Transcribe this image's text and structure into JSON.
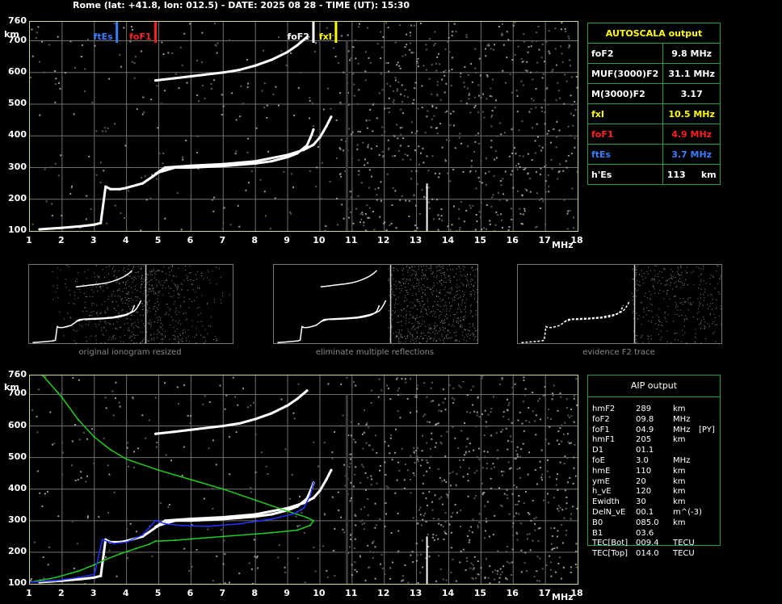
{
  "header": {
    "title": "Rome (lat: +41.8, lon: 012.5) - DATE: 2025 08 28 - TIME (UT): 15:30"
  },
  "axes": {
    "y_ticks": [
      "760",
      "700",
      "600",
      "500",
      "400",
      "300",
      "200",
      "100"
    ],
    "y_unit": "km",
    "x_ticks": [
      "1",
      "2",
      "3",
      "4",
      "5",
      "6",
      "7",
      "8",
      "9",
      "10",
      "11",
      "12",
      "13",
      "14",
      "15",
      "16",
      "17",
      "18"
    ],
    "x_unit": "MHz"
  },
  "markers": [
    {
      "label": "ftEs",
      "freq": 3.7,
      "color": "#3a7dff"
    },
    {
      "label": "foF1",
      "freq": 4.9,
      "color": "#ff2020"
    },
    {
      "label": "foF2",
      "freq": 9.8,
      "color": "#ffffff"
    },
    {
      "label": "fxI",
      "freq": 10.5,
      "color": "#ffff00"
    }
  ],
  "thumbnails": [
    {
      "caption": "original ionogram resized"
    },
    {
      "caption": "eliminate multiple reflections"
    },
    {
      "caption": "evidence F2 trace"
    }
  ],
  "autoscala": {
    "title": "AUTOSCALA output",
    "rows": [
      {
        "name": "foF2",
        "value": "9.8 MHz",
        "color": "#ffffff"
      },
      {
        "name": "MUF(3000)F2",
        "value": "31.1 MHz",
        "color": "#ffffff"
      },
      {
        "name": "M(3000)F2",
        "value": "3.17",
        "color": "#ffffff"
      },
      {
        "name": "fxI",
        "value": "10.5 MHz",
        "color": "#ffff00"
      },
      {
        "name": "foF1",
        "value": "4.9 MHz",
        "color": "#ff2020"
      },
      {
        "name": "ftEs",
        "value": "3.7 MHz",
        "color": "#3a7dff"
      },
      {
        "name": "h'Es",
        "value": "113     km",
        "color": "#ffffff"
      }
    ]
  },
  "aip": {
    "title": "AIP output",
    "rows": [
      {
        "name": "hmF2",
        "value": "289",
        "unit": "km",
        "extra": ""
      },
      {
        "name": "foF2",
        "value": "09.8",
        "unit": "MHz",
        "extra": ""
      },
      {
        "name": "foF1",
        "value": "04.9",
        "unit": "MHz",
        "extra": "[PY]"
      },
      {
        "name": "hmF1",
        "value": "205",
        "unit": "km",
        "extra": ""
      },
      {
        "name": "D1",
        "value": "01.1",
        "unit": "",
        "extra": ""
      },
      {
        "name": "foE",
        "value": "3.0",
        "unit": "MHz",
        "extra": ""
      },
      {
        "name": "hmE",
        "value": "110",
        "unit": "km",
        "extra": ""
      },
      {
        "name": "ymE",
        "value": "20",
        "unit": "km",
        "extra": ""
      },
      {
        "name": "h_vE",
        "value": "120",
        "unit": "km",
        "extra": ""
      },
      {
        "name": "Ewidth",
        "value": "30",
        "unit": "km",
        "extra": ""
      },
      {
        "name": "DelN_vE",
        "value": "00.1",
        "unit": "m^(-3)",
        "extra": ""
      },
      {
        "name": "B0",
        "value": "085.0",
        "unit": "km",
        "extra": ""
      },
      {
        "name": "B1",
        "value": "03.6",
        "unit": "",
        "extra": ""
      },
      {
        "name": "TEC[Bot]",
        "value": "009.4",
        "unit": "TECU",
        "extra": ""
      },
      {
        "name": "TEC[Top]",
        "value": "014.0",
        "unit": "TECU",
        "extra": ""
      }
    ]
  },
  "colors": {
    "frame": "#d4d48c",
    "grid": "#707070",
    "table_border": "#2a9a4a",
    "trace": "#ffffff",
    "profile_true_height": "#22cc22",
    "profile_fit": "#2233ff"
  },
  "chart_data": [
    {
      "type": "scatter",
      "title": "",
      "xlabel": "MHz",
      "ylabel": "km",
      "xlim": [
        1,
        18
      ],
      "ylim": [
        100,
        760
      ],
      "grid": true,
      "series": [
        {
          "name": "",
          "color": "#ffffff",
          "points": [
            [
              1.3,
              105
            ],
            [
              2.0,
              110
            ],
            [
              2.6,
              115
            ],
            [
              3.0,
              120
            ],
            [
              3.2,
              125
            ],
            [
              3.35,
              240
            ],
            [
              3.5,
              232
            ],
            [
              3.8,
              232
            ],
            [
              4.0,
              236
            ],
            [
              4.5,
              250
            ],
            [
              5.0,
              285
            ],
            [
              5.5,
              300
            ],
            [
              6.0,
              300
            ],
            [
              7.0,
              305
            ],
            [
              8.0,
              313
            ],
            [
              8.5,
              320
            ],
            [
              9.0,
              333
            ],
            [
              9.3,
              345
            ],
            [
              9.6,
              370
            ],
            [
              9.75,
              405
            ],
            [
              9.8,
              420
            ]
          ]
        },
        {
          "name": "",
          "color": "#ffffff",
          "points": [
            [
              4.9,
              280
            ],
            [
              5.2,
              300
            ],
            [
              6.0,
              306
            ],
            [
              7.0,
              311
            ],
            [
              8.0,
              320
            ],
            [
              9.0,
              340
            ],
            [
              9.5,
              356
            ],
            [
              9.8,
              372
            ],
            [
              10.0,
              395
            ],
            [
              10.2,
              430
            ],
            [
              10.35,
              460
            ]
          ]
        },
        {
          "name": "",
          "color": "#ffffff",
          "points": [
            [
              4.9,
              575
            ],
            [
              5.5,
              582
            ],
            [
              6.0,
              588
            ],
            [
              7.0,
              600
            ],
            [
              7.5,
              608
            ],
            [
              8.0,
              622
            ],
            [
              8.5,
              640
            ],
            [
              9.0,
              665
            ],
            [
              9.3,
              686
            ],
            [
              9.6,
              712
            ]
          ]
        }
      ]
    },
    {
      "type": "line",
      "title": "",
      "xlabel": "MHz",
      "ylabel": "km",
      "xlim": [
        1,
        18
      ],
      "ylim": [
        100,
        760
      ],
      "grid": true,
      "series": [
        {
          "name": "",
          "color": "#22cc22",
          "points": [
            [
              1.4,
              760
            ],
            [
              2.0,
              690
            ],
            [
              2.5,
              620
            ],
            [
              3.0,
              565
            ],
            [
              3.5,
              525
            ],
            [
              4.0,
              495
            ],
            [
              5.0,
              460
            ],
            [
              6.0,
              430
            ],
            [
              7.0,
              400
            ],
            [
              8.0,
              365
            ],
            [
              9.0,
              330
            ],
            [
              9.6,
              310
            ],
            [
              9.8,
              300
            ],
            [
              9.7,
              285
            ],
            [
              9.3,
              270
            ],
            [
              8.5,
              262
            ],
            [
              7.0,
              250
            ],
            [
              6.0,
              242
            ],
            [
              5.5,
              238
            ],
            [
              4.9,
              235
            ],
            [
              4.7,
              225
            ],
            [
              4.3,
              212
            ],
            [
              3.8,
              195
            ],
            [
              3.3,
              175
            ],
            [
              3.0,
              160
            ],
            [
              2.5,
              140
            ],
            [
              1.8,
              120
            ],
            [
              1.0,
              105
            ]
          ]
        },
        {
          "name": "",
          "color": "#2233ff",
          "points": [
            [
              1.0,
              105
            ],
            [
              1.8,
              110
            ],
            [
              2.5,
              120
            ],
            [
              3.0,
              130
            ],
            [
              3.25,
              240
            ],
            [
              3.6,
              228
            ],
            [
              4.0,
              232
            ],
            [
              4.5,
              255
            ],
            [
              4.9,
              300
            ],
            [
              5.2,
              290
            ],
            [
              5.7,
              285
            ],
            [
              6.5,
              282
            ],
            [
              7.5,
              290
            ],
            [
              8.5,
              305
            ],
            [
              9.2,
              322
            ],
            [
              9.5,
              340
            ],
            [
              9.7,
              380
            ],
            [
              9.8,
              420
            ]
          ]
        }
      ]
    }
  ]
}
